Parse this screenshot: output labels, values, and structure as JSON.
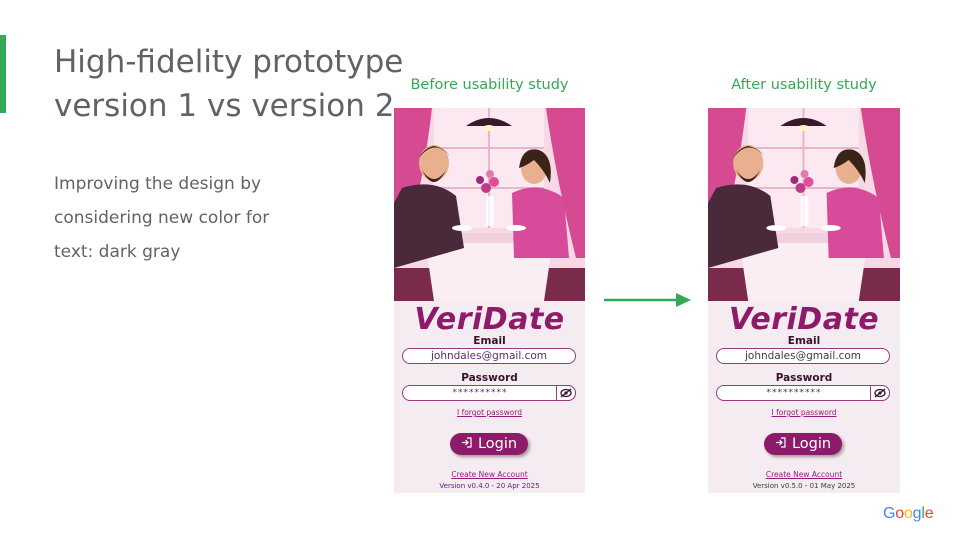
{
  "slide": {
    "title_line1": "High-fidelity prototype",
    "title_line2": "version 1 vs version 2",
    "subtitle_line1": "Improving the design by",
    "subtitle_line2": "considering new color for",
    "subtitle_line3": "text: dark gray"
  },
  "before": {
    "caption": "Before usability study",
    "brand": "VeriDate",
    "email_label": "Email",
    "email_value": "johndales@gmail.com",
    "password_label": "Password",
    "password_value": "**********",
    "forgot_link": "I forgot password",
    "login_label": "Login",
    "create_link": "Create New Account",
    "version": "Version v0.4.0 - 20 Apr 2025"
  },
  "after": {
    "caption": "After usability study",
    "brand": "VeriDate",
    "email_label": "Email",
    "email_value": "johndales@gmail.com",
    "password_label": "Password",
    "password_value": "**********",
    "forgot_link": "I forgot password",
    "login_label": "Login",
    "create_link": "Create New Account",
    "version": "Version v0.5.0 - 01 May 2025"
  },
  "icons": {
    "eye_toggle": "eye-slash-icon",
    "login": "login-arrow-icon",
    "transition_arrow": "right-arrow-icon"
  },
  "colors": {
    "accent_green": "#34a853",
    "brand_purple": "#8e1a6a",
    "text_gray": "#5f6368",
    "v2_text_dark_gray": "#3c3c3c"
  },
  "logo": {
    "g1": "G",
    "o1": "o",
    "o2": "o",
    "g2": "g",
    "l": "l",
    "e": "e"
  }
}
